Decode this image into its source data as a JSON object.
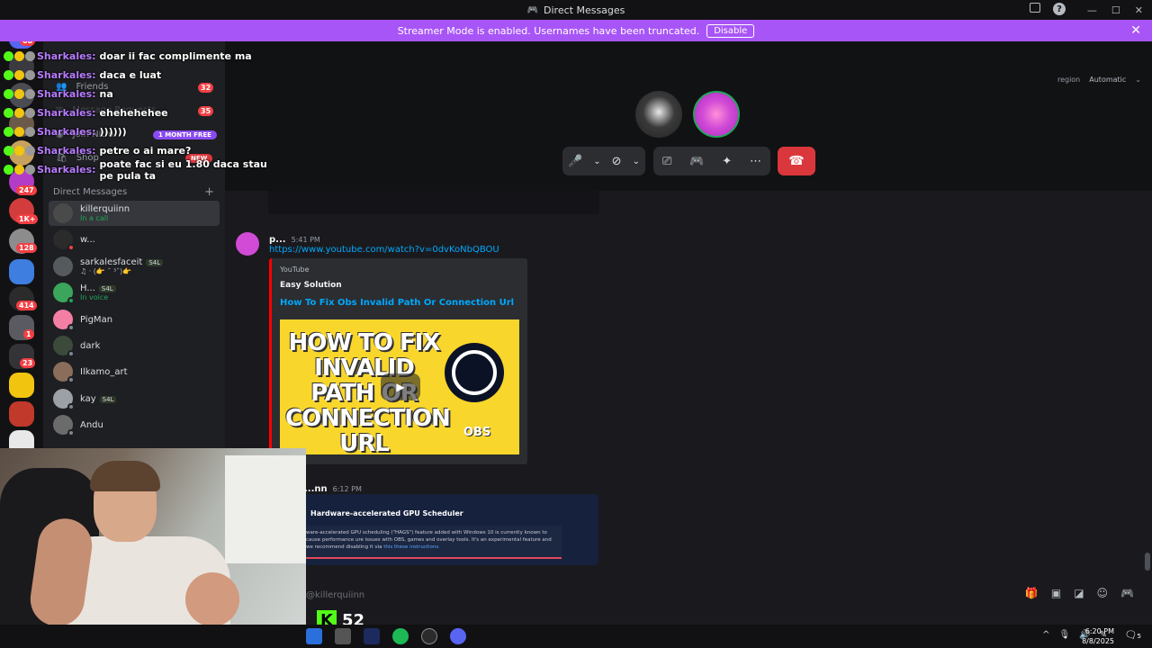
{
  "window": {
    "title": "Direct Messages"
  },
  "banner": {
    "text": "Streamer Mode is enabled. Usernames have been truncated.",
    "button": "Disable"
  },
  "rail_badges": [
    "68",
    "247",
    "1K+",
    "128",
    "414",
    "1",
    "23"
  ],
  "sidebar": {
    "nav": [
      {
        "label": "Friends",
        "badge": "32"
      },
      {
        "label": "Message Requests",
        "badge": "35"
      },
      {
        "label": "Join Nitro",
        "pill": "1 MONTH FREE"
      },
      {
        "label": "Shop",
        "pill": "NEW"
      }
    ],
    "section_title": "Direct Messages",
    "dms": [
      {
        "name": "killerquiinn",
        "sub": "In a call",
        "color": "#4a4a4a",
        "active": true
      },
      {
        "name": "w...",
        "sub": "",
        "color": "#2b2b2b"
      },
      {
        "name": "sarkalesfaceit",
        "sub": "♫ · (👉 ˘ ³˘)👉",
        "tag": "S4L",
        "color": "#555a5e"
      },
      {
        "name": "H...",
        "sub": "In voice",
        "tag": "S4L",
        "color": "#3ba55c"
      },
      {
        "name": "PigMan",
        "sub": "",
        "color": "#f47fa4"
      },
      {
        "name": "dark",
        "sub": "",
        "color": "#3c4a3c"
      },
      {
        "name": "Ilkamo_art",
        "sub": "",
        "color": "#8a6d5a"
      },
      {
        "name": "kay",
        "sub": "",
        "tag": "S4L",
        "color": "#9aa0a6"
      },
      {
        "name": "Andu",
        "sub": "",
        "color": "#6b6b6b"
      }
    ]
  },
  "chat_overlay": [
    {
      "user": "Sharkales:",
      "msg": "doar ii fac complimente ma"
    },
    {
      "user": "Sharkales:",
      "msg": "daca e luat"
    },
    {
      "user": "Sharkales:",
      "msg": "na"
    },
    {
      "user": "Sharkales:",
      "msg": "ehehehehee"
    },
    {
      "user": "Sharkales:",
      "msg": "))))))"
    },
    {
      "user": "Sharkales:",
      "msg": "petre o ai mare?"
    },
    {
      "user": "Sharkales:",
      "msg": "poate fac si eu 1.80 daca stau pe pula ta"
    }
  ],
  "call": {
    "region_label": "region",
    "region_value": "Automatic"
  },
  "messages": {
    "m1_author": "p...",
    "m1_time": "5:41 PM",
    "m1_link": "https://www.youtube.com/watch?v=0dvKoNbQBOU",
    "embed_provider": "YouTube",
    "embed_author": "Easy Solution",
    "embed_title": "How To Fix Obs Invalid Path Or Connection Url",
    "thumb_text": "HOW TO FIX INVALID PATH OR CONNECTION URL",
    "thumb_logo": "OBS",
    "m2_author": "...nn",
    "m2_time": "6:12 PM",
    "hags_title": "Hardware-accelerated GPU Scheduler",
    "hags_body": "ware-accelerated GPU scheduling (\"HAGS\") feature added with Windows 10 is currently known to cause performance ure issues with OBS, games and overlay tools. It's an experimental feature and we recommend disabling it via",
    "hags_link": "this these instructions."
  },
  "input": {
    "placeholder": "@killerquiinn"
  },
  "kick": {
    "count": "52"
  },
  "taskbar": {
    "time": "6:20 PM",
    "date": "8/8/2025",
    "notifications": "5"
  }
}
